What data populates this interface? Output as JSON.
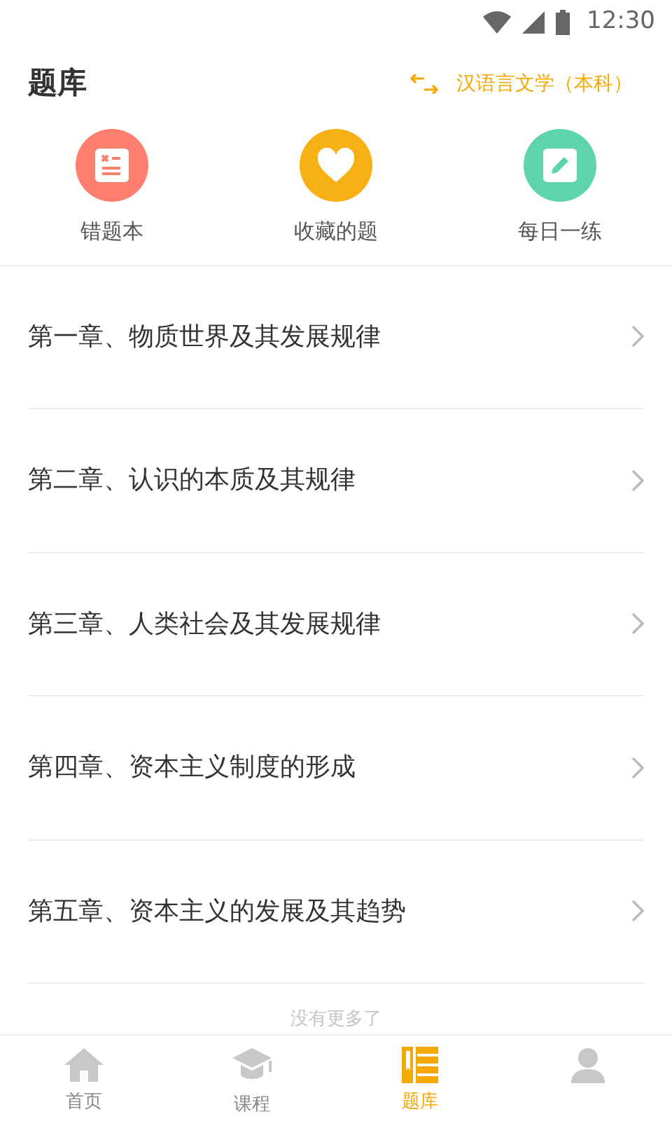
{
  "status_bar": {
    "time": "12:30"
  },
  "header": {
    "title": "题库",
    "subject": "汉语言文学（本科）"
  },
  "shortcuts": [
    {
      "kind": "wrong",
      "label": "错题本",
      "color": "#ff7f6e"
    },
    {
      "kind": "favorite",
      "label": "收藏的题",
      "color": "#f8b114"
    },
    {
      "kind": "daily",
      "label": "每日一练",
      "color": "#5dd3ae"
    }
  ],
  "chapters": [
    {
      "title": "第一章、物质世界及其发展规律"
    },
    {
      "title": "第二章、认识的本质及其规律"
    },
    {
      "title": "第三章、人类社会及其发展规律"
    },
    {
      "title": "第四章、资本主义制度的形成"
    },
    {
      "title": "第五章、资本主义的发展及其趋势"
    }
  ],
  "end_note": "没有更多了",
  "tabs": [
    {
      "kind": "home",
      "label": "首页",
      "selected": false
    },
    {
      "kind": "course",
      "label": "课程",
      "selected": false
    },
    {
      "kind": "bank",
      "label": "题库",
      "selected": true
    },
    {
      "kind": "profile",
      "selected": false
    }
  ]
}
